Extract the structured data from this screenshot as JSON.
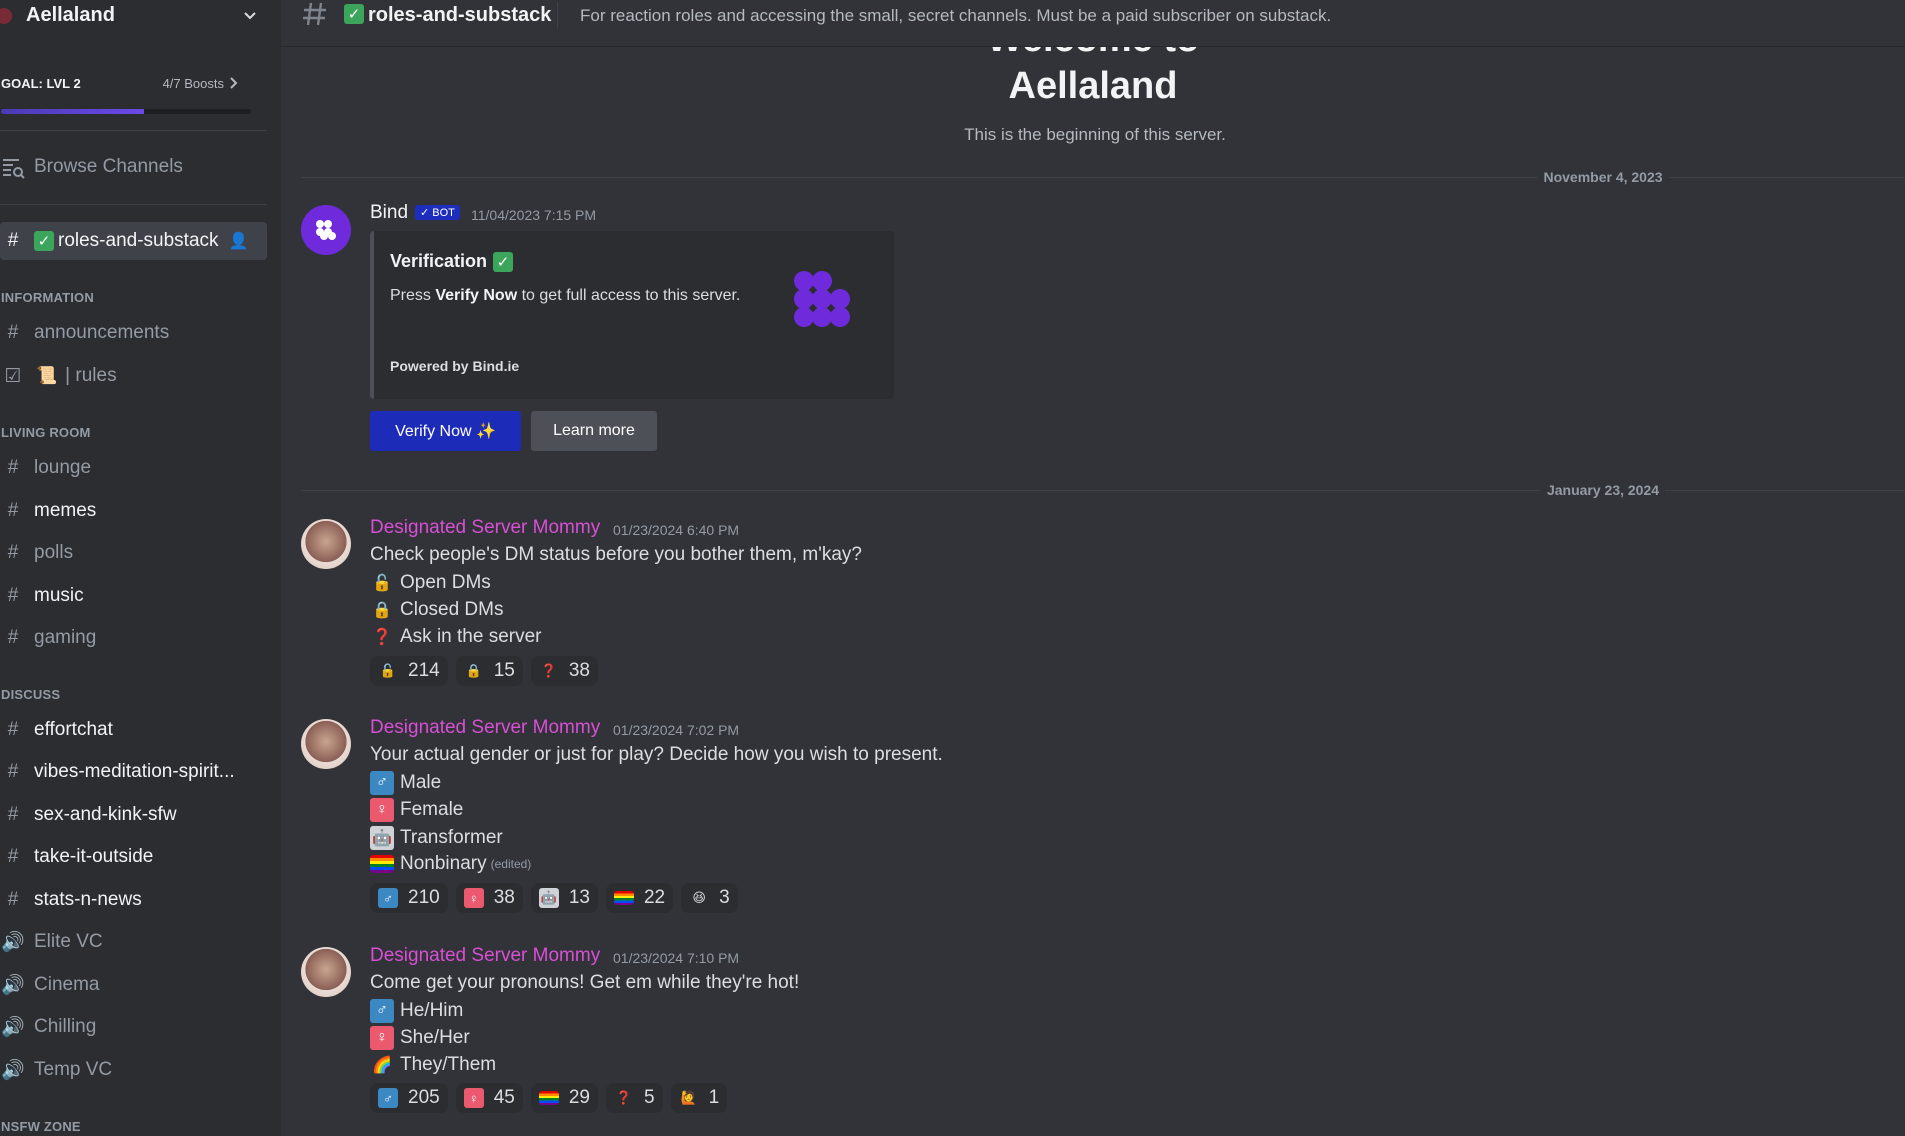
{
  "server": {
    "name": "Aellaland"
  },
  "boost": {
    "goal_label": "GOAL: LVL 2",
    "count_label": "4/7 Boosts",
    "progress": 0.57
  },
  "sidebar": {
    "browse_label": "Browse Channels",
    "active_channel": "roles-and-substack",
    "categories": {
      "information": "INFORMATION",
      "living_room": "LIVING ROOM",
      "discuss": "DISCUSS",
      "nsfw": "NSFW ZONE"
    },
    "information_channels": [
      "announcements",
      "| rules"
    ],
    "living_room_channels": [
      "lounge",
      "memes",
      "polls",
      "music",
      "gaming"
    ],
    "discuss_channels": [
      "effortchat",
      "vibes-meditation-spirit...",
      "sex-and-kink-sfw",
      "take-it-outside",
      "stats-n-news"
    ],
    "voice_channels": [
      "Elite VC",
      "Cinema",
      "Chilling",
      "Temp VC"
    ]
  },
  "topbar": {
    "channel": "roles-and-substack",
    "topic": "For reaction roles and accessing the small, secret channels. Must be a paid subscriber on substack."
  },
  "welcome": {
    "line1": "Welcome to",
    "line2": "Aellaland",
    "subtitle": "This is the beginning of this server."
  },
  "dates": {
    "d1": "November 4, 2023",
    "d2": "January 23, 2024"
  },
  "bot_message": {
    "author": "Bind",
    "tag": "✓ BOT",
    "timestamp": "11/04/2023 7:15 PM",
    "embed_title": "Verification",
    "embed_desc_pre": "Press ",
    "embed_desc_bold": "Verify Now",
    "embed_desc_post": " to get full access to this server.",
    "embed_footer": "Powered by Bind.ie",
    "verify_button": "Verify Now ✨",
    "learn_button": "Learn more"
  },
  "messages": [
    {
      "author": "Designated Server Mommy",
      "timestamp": "01/23/2024 6:40 PM",
      "text": "Check people's DM status before you bother them, m'kay?",
      "lines": [
        "Open DMs",
        "Closed DMs",
        "Ask in the server"
      ],
      "reactions": [
        "214",
        "15",
        "38"
      ]
    },
    {
      "author": "Designated Server Mommy",
      "timestamp": "01/23/2024 7:02 PM",
      "text": "Your actual gender or just for play? Decide how you wish to present.",
      "lines": [
        "Male",
        "Female",
        "Transformer",
        "Nonbinary"
      ],
      "edited": "(edited)",
      "reactions": [
        "210",
        "38",
        "13",
        "22",
        "3"
      ]
    },
    {
      "author": "Designated Server Mommy",
      "timestamp": "01/23/2024 7:10 PM",
      "text": "Come get your pronouns! Get em while they're hot!",
      "lines": [
        "He/Him",
        "She/Her",
        "They/Them"
      ],
      "reactions": [
        "205",
        "45",
        "29",
        "5",
        "1"
      ]
    }
  ],
  "colors": {
    "author_pink": "#d94fd6",
    "accent_blurple": "#1c2bb8",
    "bind_purple": "#6f2bdb"
  }
}
